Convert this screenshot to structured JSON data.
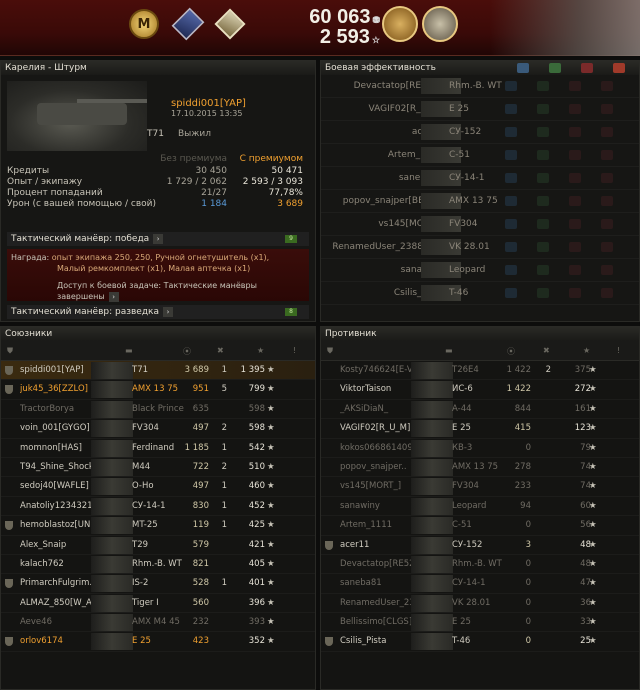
{
  "top": {
    "credits": "60 063",
    "xp": "2 593",
    "mastery": "M",
    "colors": {
      "bg": "#3a0a08",
      "accent": "#f0a030"
    }
  },
  "battle": {
    "title": "Карелия - Штурм",
    "player": "spiddi001[YAP]",
    "date": "17.10.2015 13:35",
    "vehicle": "T71",
    "status": "Выжил"
  },
  "stats": {
    "header_no_prem": "Без премиума",
    "header_prem": "С премиумом",
    "rows": [
      {
        "label": "Кредиты",
        "a": "30 450",
        "b": "50 471"
      },
      {
        "label": "Опыт / экипажу",
        "a": "1 729 / 2 062",
        "b": "2 593 / 3 093"
      },
      {
        "label": "Процент попаданий",
        "a": "21/27",
        "b": "77,78%"
      },
      {
        "label": "Урон (с вашей помощью / свой)",
        "a": "1 184",
        "b": "3 689"
      }
    ]
  },
  "missions": {
    "m1": "Тактический манёвр: победа",
    "m1_done": "9",
    "reward_label": "Награда:",
    "reward_line1": "опыт экипажа 250, 250, Ручной огнетушитель (x1),",
    "reward_line2": "Малый ремкомплект (x1), Малая аптечка (x1)",
    "access": "Доступ к боевой задаче: Тактические манёвры завершены",
    "m2": "Тактический манёвр: разведка",
    "m2_done": "8"
  },
  "efficiency": {
    "title": "Боевая эффективность",
    "rows": [
      {
        "name": "Devactatop[RE52G]",
        "tank": "Rhm.-B. WT"
      },
      {
        "name": "VAGIF02[R_U_M]",
        "tank": "E 25"
      },
      {
        "name": "acer11",
        "tank": "СУ-152"
      },
      {
        "name": "Artem_1111",
        "tank": "С-51"
      },
      {
        "name": "saneba81",
        "tank": "СУ-14-1"
      },
      {
        "name": "popov_snajper[BES_T]",
        "tank": "AMX 13 75"
      },
      {
        "name": "vs145[MORT_]",
        "tank": "FV304"
      },
      {
        "name": "RenamedUser_238804...",
        "tank": "VK 28.01"
      },
      {
        "name": "sanawiny",
        "tank": "Leopard"
      },
      {
        "name": "Csilis_Pista",
        "tank": "T-46"
      }
    ]
  },
  "allies": {
    "title": "Союзники",
    "rows": [
      {
        "name": "spiddi001[YAP]",
        "tank": "T71",
        "dmg": "3 689",
        "kills": "1",
        "xp": "1 395"
      },
      {
        "name": "juk45_36[ZZLO]",
        "tank": "AMX 13 75",
        "dmg": "951",
        "kills": "5",
        "xp": "799"
      },
      {
        "name": "TractorBorya",
        "tank": "Black Prince",
        "dmg": "635",
        "kills": "",
        "xp": "598"
      },
      {
        "name": "voin_001[GYGO]",
        "tank": "FV304",
        "dmg": "497",
        "kills": "2",
        "xp": "598"
      },
      {
        "name": "momnon[HAS]",
        "tank": "Ferdinand",
        "dmg": "1 185",
        "kills": "1",
        "xp": "542"
      },
      {
        "name": "T94_Shine_Shock..",
        "tank": "M44",
        "dmg": "722",
        "kills": "2",
        "xp": "510"
      },
      {
        "name": "sedoj40[WAFLE]",
        "tank": "O-Ho",
        "dmg": "497",
        "kills": "1",
        "xp": "460"
      },
      {
        "name": "Anatoliy1234321",
        "tank": "СУ-14-1",
        "dmg": "830",
        "kills": "1",
        "xp": "452"
      },
      {
        "name": "hemoblastoz[UNIKS]",
        "tank": "MT-25",
        "dmg": "119",
        "kills": "1",
        "xp": "425"
      },
      {
        "name": "Alex_Snaip",
        "tank": "T29",
        "dmg": "579",
        "kills": "",
        "xp": "421"
      },
      {
        "name": "kalach762",
        "tank": "Rhm.-B. WT",
        "dmg": "821",
        "kills": "",
        "xp": "405"
      },
      {
        "name": "PrimarchFulgrim..",
        "tank": "IS-2",
        "dmg": "528",
        "kills": "1",
        "xp": "401"
      },
      {
        "name": "ALMAZ_850[W_A_T]",
        "tank": "Tiger I",
        "dmg": "560",
        "kills": "",
        "xp": "396"
      },
      {
        "name": "Aeve46",
        "tank": "AMX M4 45",
        "dmg": "232",
        "kills": "",
        "xp": "393"
      },
      {
        "name": "orlov6174",
        "tank": "E 25",
        "dmg": "423",
        "kills": "",
        "xp": "352"
      }
    ]
  },
  "enemies": {
    "title": "Противник",
    "rows": [
      {
        "name": "Kosty746624[E-V-E]",
        "tank": "T26E4",
        "dmg": "1 422",
        "kills": "2",
        "xp": "375"
      },
      {
        "name": "ViktorTaison",
        "tank": "ИС-6",
        "dmg": "1 422",
        "kills": "",
        "xp": "272"
      },
      {
        "name": "_AKSiDiaN_",
        "tank": "A-44",
        "dmg": "844",
        "kills": "",
        "xp": "161"
      },
      {
        "name": "VAGIF02[R_U_M]",
        "tank": "E 25",
        "dmg": "415",
        "kills": "",
        "xp": "123"
      },
      {
        "name": "kokos0668614092..",
        "tank": "КВ-3",
        "dmg": "0",
        "kills": "",
        "xp": "79"
      },
      {
        "name": "popov_snajper..",
        "tank": "AMX 13 75",
        "dmg": "278",
        "kills": "",
        "xp": "74"
      },
      {
        "name": "vs145[MORT_]",
        "tank": "FV304",
        "dmg": "233",
        "kills": "",
        "xp": "74"
      },
      {
        "name": "sanawiny",
        "tank": "Leopard",
        "dmg": "94",
        "kills": "",
        "xp": "60"
      },
      {
        "name": "Artem_1111",
        "tank": "С-51",
        "dmg": "0",
        "kills": "",
        "xp": "56"
      },
      {
        "name": "acer11",
        "tank": "СУ-152",
        "dmg": "3",
        "kills": "",
        "xp": "48"
      },
      {
        "name": "Devactatop[RE52G]",
        "tank": "Rhm.-B. WT",
        "dmg": "0",
        "kills": "",
        "xp": "48"
      },
      {
        "name": "saneba81",
        "tank": "СУ-14-1",
        "dmg": "0",
        "kills": "",
        "xp": "47"
      },
      {
        "name": "RenamedUser_2388..",
        "tank": "VK 28.01",
        "dmg": "0",
        "kills": "",
        "xp": "36"
      },
      {
        "name": "Bellissimo[CLGS]",
        "tank": "E 25",
        "dmg": "0",
        "kills": "",
        "xp": "33"
      },
      {
        "name": "Csilis_Pista",
        "tank": "T-46",
        "dmg": "0",
        "kills": "",
        "xp": "25"
      }
    ]
  }
}
